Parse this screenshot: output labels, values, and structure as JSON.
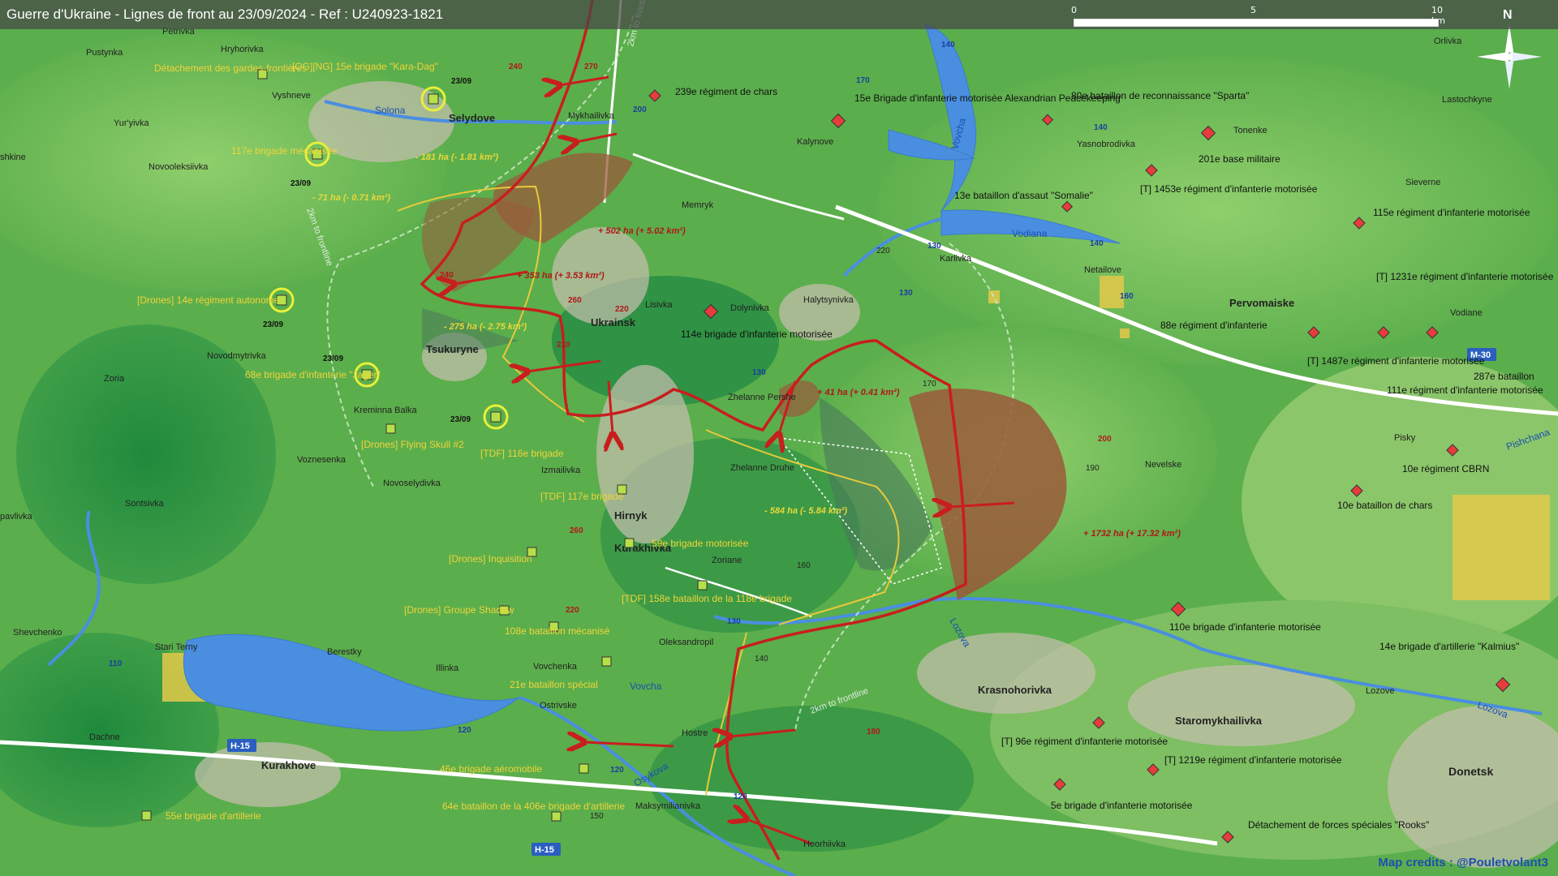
{
  "header": {
    "title": "Guerre d'Ukraine - Lignes de front au 23/09/2024 - Ref : U240923-1821"
  },
  "scale": {
    "labels": [
      "0",
      "5",
      "10 km"
    ]
  },
  "compass": {
    "label": "N",
    "icon": "compass-rose-icon"
  },
  "colors": {
    "front_line": "#c81e1e",
    "ukr_unit": "#b6e04a",
    "rus_unit": "#e63c3c",
    "gain_area": "#9a5a3a",
    "loss_area": "#4a7a5a",
    "road": "#2a5fc0",
    "water": "#4a8ee0"
  },
  "towns": [
    {
      "label": "Selydove",
      "bold": true
    },
    {
      "label": "Ukrainsk",
      "bold": true
    },
    {
      "label": "Tsukuryne",
      "bold": true
    },
    {
      "label": "Hirnyk",
      "bold": true
    },
    {
      "label": "Kurakhivka",
      "bold": true
    },
    {
      "label": "Kurakhove",
      "bold": true
    },
    {
      "label": "Krasnohorivka",
      "bold": true
    },
    {
      "label": "Staromykhailivka",
      "bold": true
    },
    {
      "label": "Donetsk",
      "bold": true
    },
    {
      "label": "Pervomaiske",
      "bold": true
    },
    {
      "label": "Petrivka"
    },
    {
      "label": "Hryhorivka"
    },
    {
      "label": "Pustynka"
    },
    {
      "label": "Vyshneve"
    },
    {
      "label": "Yur'yivka"
    },
    {
      "label": "Novooleksiivka"
    },
    {
      "label": "Mykhailivka"
    },
    {
      "label": "Memryk"
    },
    {
      "label": "Kalynove"
    },
    {
      "label": "Karlivka"
    },
    {
      "label": "Netailove"
    },
    {
      "label": "Lisivka"
    },
    {
      "label": "Dolynivka"
    },
    {
      "label": "Halytsynivka"
    },
    {
      "label": "Zhelanne Pershe"
    },
    {
      "label": "Zhelanne Druhe"
    },
    {
      "label": "Novodmytrivka"
    },
    {
      "label": "Zoria"
    },
    {
      "label": "Kreminna Balka"
    },
    {
      "label": "Voznesenka"
    },
    {
      "label": "Izmailivka"
    },
    {
      "label": "Novoselydivka"
    },
    {
      "label": "Sontsivka"
    },
    {
      "label": "Zoriane"
    },
    {
      "label": "Oleksandropil"
    },
    {
      "label": "Vovchenka"
    },
    {
      "label": "Illinka"
    },
    {
      "label": "Berestky"
    },
    {
      "label": "Stari Terny"
    },
    {
      "label": "Shevchenko"
    },
    {
      "label": "Dachne"
    },
    {
      "label": "Ostrivske"
    },
    {
      "label": "Hostre"
    },
    {
      "label": "Maksymilianivka"
    },
    {
      "label": "Heorhiivka"
    },
    {
      "label": "Orlivka"
    },
    {
      "label": "Lastochkyne"
    },
    {
      "label": "Tonenke"
    },
    {
      "label": "Yasnobrodivka"
    },
    {
      "label": "Sieverne"
    },
    {
      "label": "Vodiane"
    },
    {
      "label": "Nevelske"
    },
    {
      "label": "Pisky"
    },
    {
      "label": "Lozove"
    },
    {
      "label": "pavlivka"
    },
    {
      "label": "shkine"
    }
  ],
  "rivers": [
    {
      "label": "Solona"
    },
    {
      "label": "Vodiana"
    },
    {
      "label": "Vovcha"
    },
    {
      "label": "Lozova"
    },
    {
      "label": "Osykova"
    },
    {
      "label": "Pishchana"
    }
  ],
  "roads": [
    {
      "label": "H-15"
    },
    {
      "label": "H-15"
    },
    {
      "label": "M-30"
    }
  ],
  "road_numbers": [
    "140",
    "140",
    "140",
    "170",
    "200",
    "130",
    "130",
    "130",
    "130",
    "160",
    "120",
    "120",
    "120",
    "110"
  ],
  "elevations": [
    "240",
    "270",
    "260",
    "220",
    "210",
    "260",
    "220",
    "180",
    "200",
    "190",
    "170",
    "160",
    "150",
    "140",
    "230",
    "250"
  ],
  "area_changes": [
    {
      "label": "- 181 ha (- 1.81 km²)",
      "kind": "loss"
    },
    {
      "label": "- 71 ha (- 0.71 km²)",
      "kind": "loss"
    },
    {
      "label": "+ 502 ha (+ 5.02 km²)",
      "kind": "gain"
    },
    {
      "label": "+ 353 ha (+ 3.53 km²)",
      "kind": "gain"
    },
    {
      "label": "- 275 ha (- 2.75 km²)",
      "kind": "loss"
    },
    {
      "label": "+ 41 ha (+ 0.41 km²)",
      "kind": "gain"
    },
    {
      "label": "- 584 ha (- 5.84 km²)",
      "kind": "loss"
    },
    {
      "label": "+ 1732 ha (+ 17.32 km²)",
      "kind": "gain"
    }
  ],
  "frontline_notes": [
    "2km to frontline",
    "2km to frontline",
    "2km to frontline"
  ],
  "ukr_units": [
    {
      "label": "Détachement des gardes-frontières"
    },
    {
      "label": "[OG][NG] 15e brigade \"Kara-Dag\"",
      "date": "23/09"
    },
    {
      "label": "117e brigade mécanisée",
      "date": "23/09"
    },
    {
      "label": "[Drones] 14e régiment autonome",
      "date": "23/09"
    },
    {
      "label": "68e brigade d'infanterie \"Jager\"",
      "date": "23/09"
    },
    {
      "label": "[Drones] Flying Skull #2"
    },
    {
      "label": "[TDF] 116e brigade",
      "date": "23/09"
    },
    {
      "label": "[TDF] 117e brigade"
    },
    {
      "label": "59e brigade motorisée"
    },
    {
      "label": "[Drones] Inquisition"
    },
    {
      "label": "[Drones] Groupe Shadow"
    },
    {
      "label": "[TDF] 158e bataillon de la 118e brigade"
    },
    {
      "label": "108e bataillon mécanisé"
    },
    {
      "label": "21e bataillon spécial"
    },
    {
      "label": "46e brigade aéromobile"
    },
    {
      "label": "64e bataillon de la 406e brigade d'artillerie"
    },
    {
      "label": "55e brigade d'artillerie"
    }
  ],
  "rus_units": [
    {
      "label": "239e régiment de chars"
    },
    {
      "label": "15e Brigade d'infanterie motorisée Alexandrian Peacekeeping"
    },
    {
      "label": "80e bataillon de reconnaissance \"Sparta\""
    },
    {
      "label": "201e base militaire"
    },
    {
      "label": "[T] 1453e régiment d'infanterie motorisée"
    },
    {
      "label": "13e bataillon d'assaut \"Somalie\""
    },
    {
      "label": "115e régiment d'infanterie motorisée"
    },
    {
      "label": "[T] 1231e régiment d'infanterie motorisée"
    },
    {
      "label": "114e brigade d'infanterie motorisée"
    },
    {
      "label": "88e régiment d'infanterie"
    },
    {
      "label": "[T] 1487e régiment d'infanterie motorisée"
    },
    {
      "label": "287e bataillon"
    },
    {
      "label": "111e régiment d'infanterie motorisée"
    },
    {
      "label": "10e régiment CBRN"
    },
    {
      "label": "10e bataillon de chars"
    },
    {
      "label": "110e brigade d'infanterie motorisée"
    },
    {
      "label": "14e brigade d'artillerie \"Kalmius\""
    },
    {
      "label": "[T] 96e régiment d'infanterie motorisée"
    },
    {
      "label": "[T] 1219e régiment d'infanterie motorisée"
    },
    {
      "label": "5e brigade d'infanterie motorisée"
    },
    {
      "label": "Détachement de forces spéciales \"Rooks\""
    }
  ],
  "credits": "Map credits : @Pouletvolant3"
}
